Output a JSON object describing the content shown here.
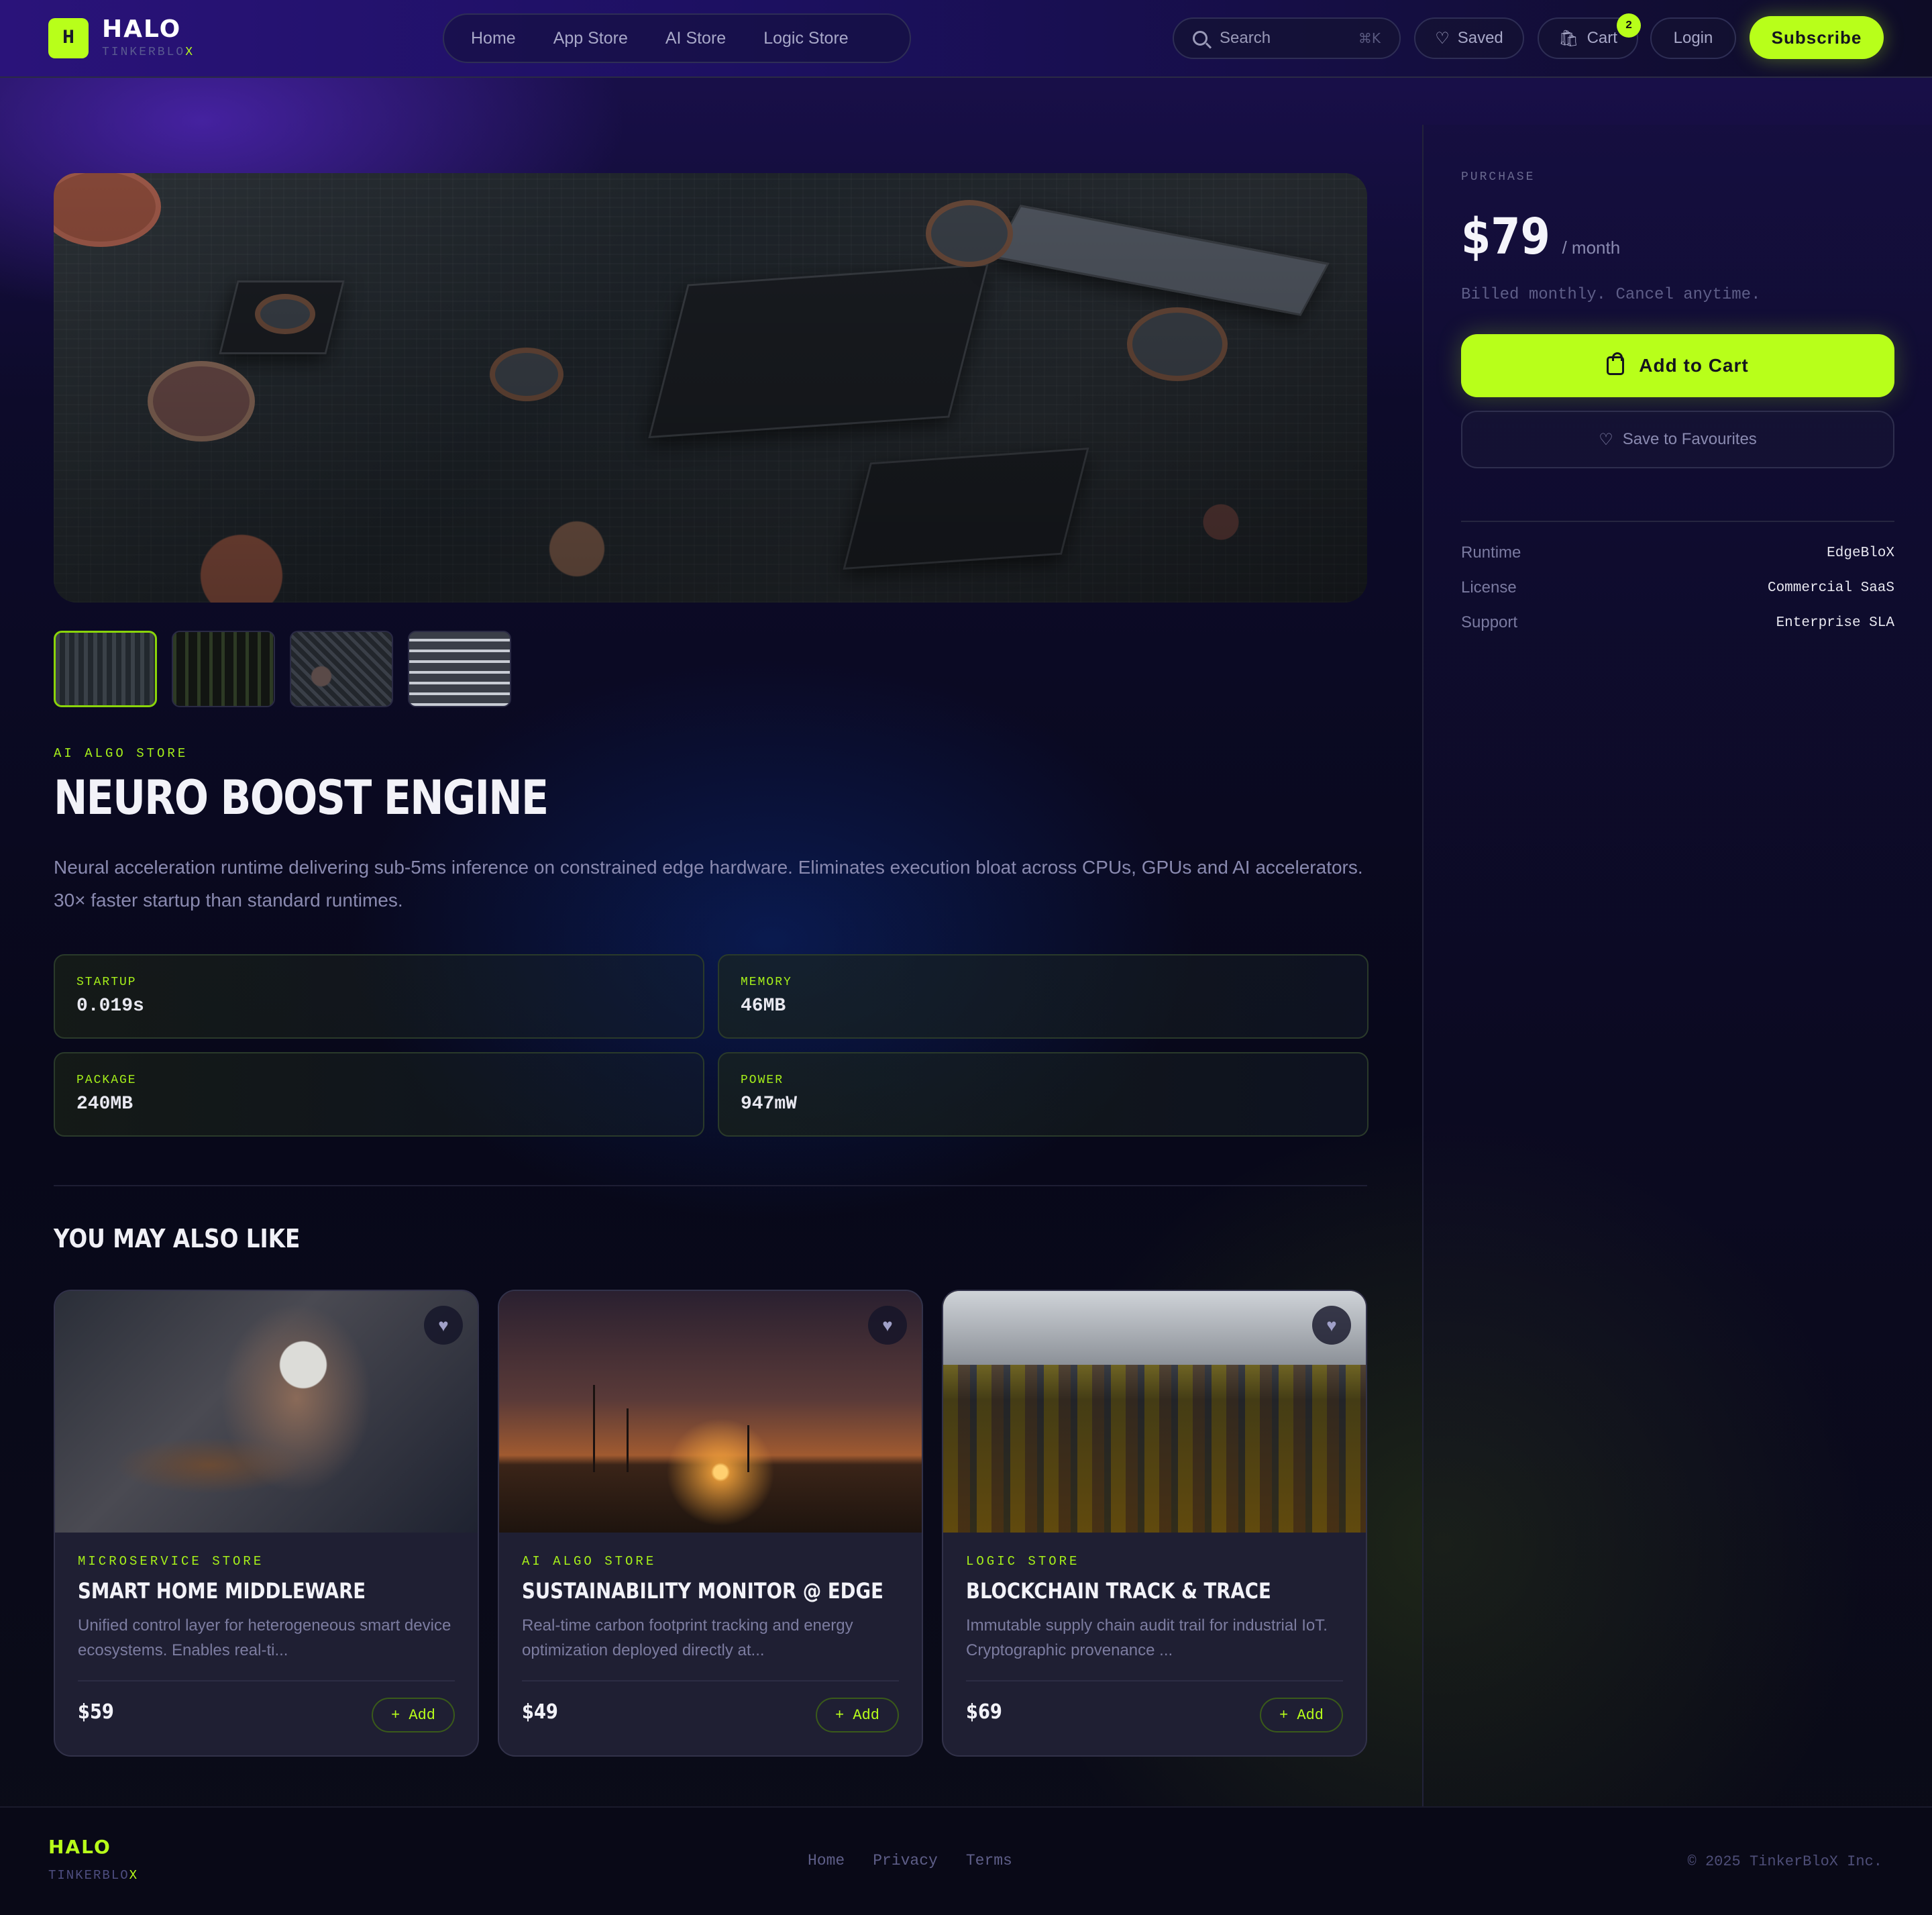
{
  "header": {
    "logo_mark": "H",
    "logo_title": "HALO",
    "logo_sub_main": "TINKERBLO",
    "logo_sub_x": "X",
    "nav": [
      "Home",
      "App Store",
      "AI Store",
      "Logic Store"
    ],
    "search_placeholder": "Search",
    "search_shortcut": "⌘K",
    "saved_label": "Saved",
    "cart_label": "Cart",
    "cart_count": "2",
    "login_label": "Login",
    "subscribe_label": "Subscribe"
  },
  "product": {
    "category": "AI ALGO STORE",
    "title": "NEURO BOOST ENGINE",
    "description": "Neural acceleration runtime delivering sub-5ms inference on constrained edge hardware. Eliminates execution bloat across CPUs, GPUs and AI accelerators. 30× faster startup than standard runtimes.",
    "stats": [
      {
        "label": "STARTUP",
        "value": "0.019s"
      },
      {
        "label": "MEMORY",
        "value": "46MB"
      },
      {
        "label": "PACKAGE",
        "value": "240MB"
      },
      {
        "label": "POWER",
        "value": "947mW"
      }
    ]
  },
  "related": {
    "heading": "YOU MAY ALSO LIKE",
    "cards": [
      {
        "category": "MICROSERVICE STORE",
        "title": "SMART HOME MIDDLEWARE",
        "desc": "Unified control layer for heterogeneous smart device ecosystems. Enables real-ti...",
        "price": "$59",
        "add_label": "+ Add"
      },
      {
        "category": "AI ALGO STORE",
        "title": "SUSTAINABILITY MONITOR @ EDGE",
        "desc": "Real-time carbon footprint tracking and energy optimization deployed directly at...",
        "price": "$49",
        "add_label": "+ Add"
      },
      {
        "category": "LOGIC STORE",
        "title": "BLOCKCHAIN TRACK & TRACE",
        "desc": "Immutable supply chain audit trail for industrial IoT. Cryptographic provenance ...",
        "price": "$69",
        "add_label": "+ Add"
      }
    ]
  },
  "purchase": {
    "eyebrow": "PURCHASE",
    "price": "$79",
    "period": "/ month",
    "billing_note": "Billed monthly. Cancel anytime.",
    "add_to_cart_label": "Add to Cart",
    "save_label": "Save to Favourites",
    "specs": [
      {
        "label": "Runtime",
        "value": "EdgeBloX"
      },
      {
        "label": "License",
        "value": "Commercial SaaS"
      },
      {
        "label": "Support",
        "value": "Enterprise SLA"
      }
    ]
  },
  "footer": {
    "logo": "HALO",
    "sub_main": "TINKERBLO",
    "sub_x": "X",
    "links": [
      "Home",
      "Privacy",
      "Terms"
    ],
    "copyright": "© 2025 TinkerBloX Inc."
  },
  "colors": {
    "accent": "#b8ff1a",
    "background": "#0a0a18",
    "header": "#1c1060"
  },
  "icons": [
    "search-icon",
    "heart-icon",
    "bag-icon"
  ]
}
